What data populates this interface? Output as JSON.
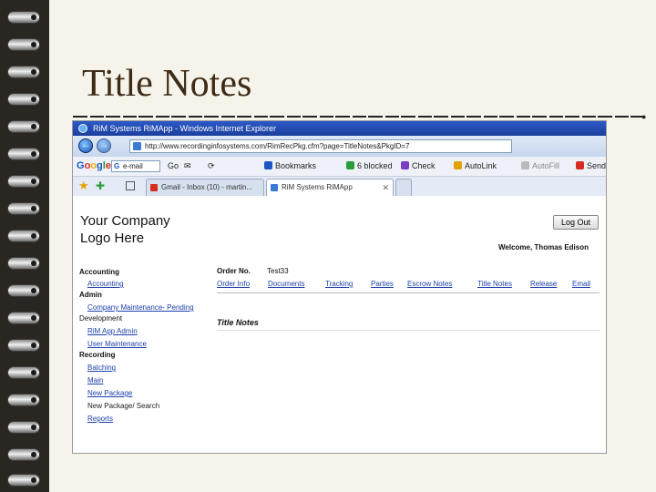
{
  "slide": {
    "title": "Title Notes"
  },
  "browser": {
    "window_title": "RiM Systems RiMApp - Windows Internet Explorer",
    "url": "http://www.recordinginfosystems.com/RimRecPkg.cfm?page=TitleNotes&PkgID=7",
    "back_icon": "back-arrow-icon",
    "forward_icon": "forward-arrow-icon"
  },
  "google_toolbar": {
    "logo": [
      "G",
      "o",
      "o",
      "g",
      "l",
      "e"
    ],
    "search_value": "e-mail",
    "go_label": "Go",
    "bookmarks_label": "Bookmarks",
    "blocked_label": "6 blocked",
    "check_label": "Check",
    "autolink_label": "AutoLink",
    "autofill_label": "AutoFill",
    "send_label": "Send"
  },
  "tabs": [
    {
      "label": "Gmail - Inbox (10) - martin...",
      "icon_color": "#d62d20"
    },
    {
      "label": "RiM Systems RiMApp",
      "icon_color": "#3a7bd5"
    }
  ],
  "page": {
    "logo_line1": "Your Company",
    "logo_line2": "Logo Here",
    "logout_label": "Log Out",
    "welcome": "Welcome, Thomas Edison",
    "sidebar": {
      "accounting_head": "Accounting",
      "accounting_link": "Accounting",
      "admin_head": "Admin",
      "company_maint": "Company Maintenance- Pending",
      "development_head": "Development",
      "rim_admin": "RiM App Admin",
      "user_maint": "User Maintenance",
      "recording_head": "Recording",
      "batching": "Batching",
      "main": "Main",
      "new_package": "New Package",
      "new_package_search": "New Package/ Search",
      "reports": "Reports"
    },
    "order_label": "Order No.",
    "order_value": "Test33",
    "order_nav": {
      "order_info": "Order Info",
      "documents": "Documents",
      "tracking": "Tracking",
      "parties": "Parties",
      "escrow_notes": "Escrow Notes",
      "title_notes": "Title Notes",
      "release": "Release",
      "email": "Email"
    },
    "section_title": "Title Notes"
  }
}
